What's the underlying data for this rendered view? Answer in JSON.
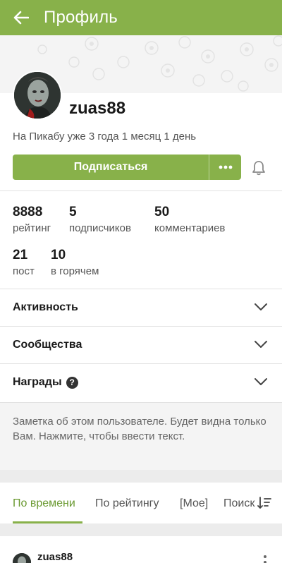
{
  "appbar": {
    "title": "Профиль",
    "back_icon": "arrow-left-icon",
    "color": "#88b14a"
  },
  "profile": {
    "username": "zuas88",
    "since": "На Пикабу уже 3 года 1 месяц 1 день",
    "subscribe_label": "Подписаться",
    "more_icon": "more-dots-icon",
    "bell_icon": "bell-icon"
  },
  "stats": [
    {
      "value": "8888",
      "label": "рейтинг"
    },
    {
      "value": "5",
      "label": "подписчиков"
    },
    {
      "value": "50",
      "label": "комментариев"
    },
    {
      "value": "21",
      "label": "пост"
    },
    {
      "value": "10",
      "label": "в горячем"
    }
  ],
  "sections": [
    {
      "label": "Активность"
    },
    {
      "label": "Сообщества"
    },
    {
      "label": "Награды"
    }
  ],
  "note": {
    "text": "Заметка об этом пользователе. Будет видна только Вам. Нажмите, чтобы ввести текст."
  },
  "tabs": [
    {
      "label": "По времени"
    },
    {
      "label": "По рейтингу"
    },
    {
      "label": "[Мое]"
    },
    {
      "label": "Поиск"
    }
  ],
  "post": {
    "username": "zuas88"
  },
  "colors": {
    "accent": "#88b14a",
    "active_tab": "#6b9a32"
  }
}
